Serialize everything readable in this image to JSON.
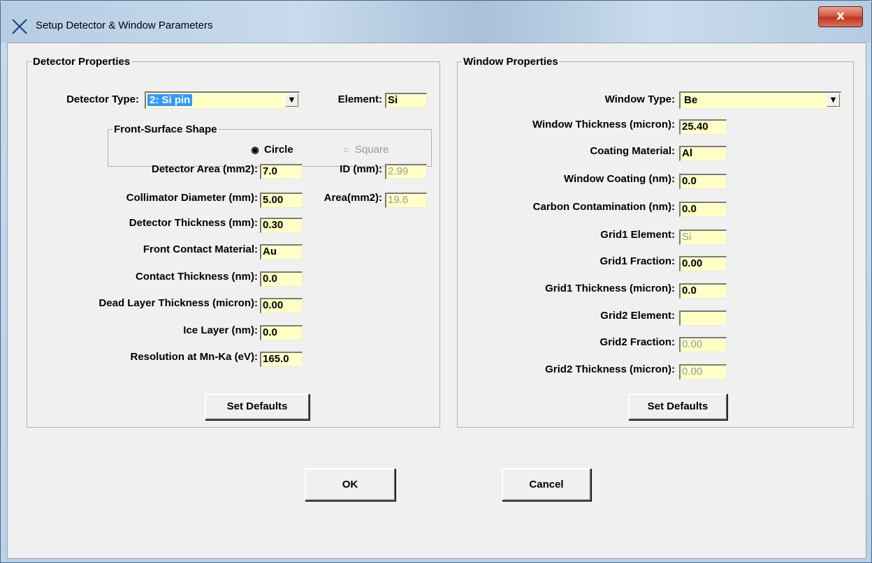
{
  "window": {
    "title": "Setup Detector & Window Parameters",
    "close_label": "x"
  },
  "detector": {
    "legend": "Detector Properties",
    "type_label": "Detector Type:",
    "type_value": "2: Si pin",
    "element_label": "Element:",
    "element_value": "Si",
    "shape_legend": "Front-Surface Shape",
    "circle_label": "Circle",
    "square_label": "Square",
    "circle_selected": true,
    "area_label": "Detector Area (mm2):",
    "area_value": "7.0",
    "id_label": "ID (mm):",
    "id_value": "2.99",
    "collimator_label": "Collimator Diameter (mm):",
    "collimator_value": "5.00",
    "coll_area_label": "Area(mm2):",
    "coll_area_value": "19.6",
    "thickness_label": "Detector Thickness (mm):",
    "thickness_value": "0.30",
    "contact_material_label": "Front Contact Material:",
    "contact_material_value": "Au",
    "contact_thickness_label": "Contact Thickness (nm):",
    "contact_thickness_value": "0.0",
    "dead_layer_label": "Dead Layer Thickness (micron):",
    "dead_layer_value": "0.00",
    "ice_layer_label": "Ice Layer (nm):",
    "ice_layer_value": "0.0",
    "resolution_label": "Resolution at Mn-Ka (eV):",
    "resolution_value": "165.0",
    "defaults_label": "Set Defaults"
  },
  "window_props": {
    "legend": "Window Properties",
    "type_label": "Window Type:",
    "type_value": "Be",
    "thickness_label": "Window Thickness (micron):",
    "thickness_value": "25.40",
    "coating_material_label": "Coating Material:",
    "coating_material_value": "Al",
    "coating_label": "Window Coating (nm):",
    "coating_value": "0.0",
    "carbon_label": "Carbon Contamination (nm):",
    "carbon_value": "0.0",
    "grid1_element_label": "Grid1 Element:",
    "grid1_element_value": "Si",
    "grid1_fraction_label": "Grid1 Fraction:",
    "grid1_fraction_value": "0.00",
    "grid1_thickness_label": "Grid1 Thickness (micron):",
    "grid1_thickness_value": "0.0",
    "grid2_element_label": "Grid2 Element:",
    "grid2_element_value": "",
    "grid2_fraction_label": "Grid2 Fraction:",
    "grid2_fraction_value": "0.00",
    "grid2_thickness_label": "Grid2 Thickness (micron):",
    "grid2_thickness_value": "0.00",
    "defaults_label": "Set Defaults"
  },
  "actions": {
    "ok_label": "OK",
    "cancel_label": "Cancel"
  }
}
